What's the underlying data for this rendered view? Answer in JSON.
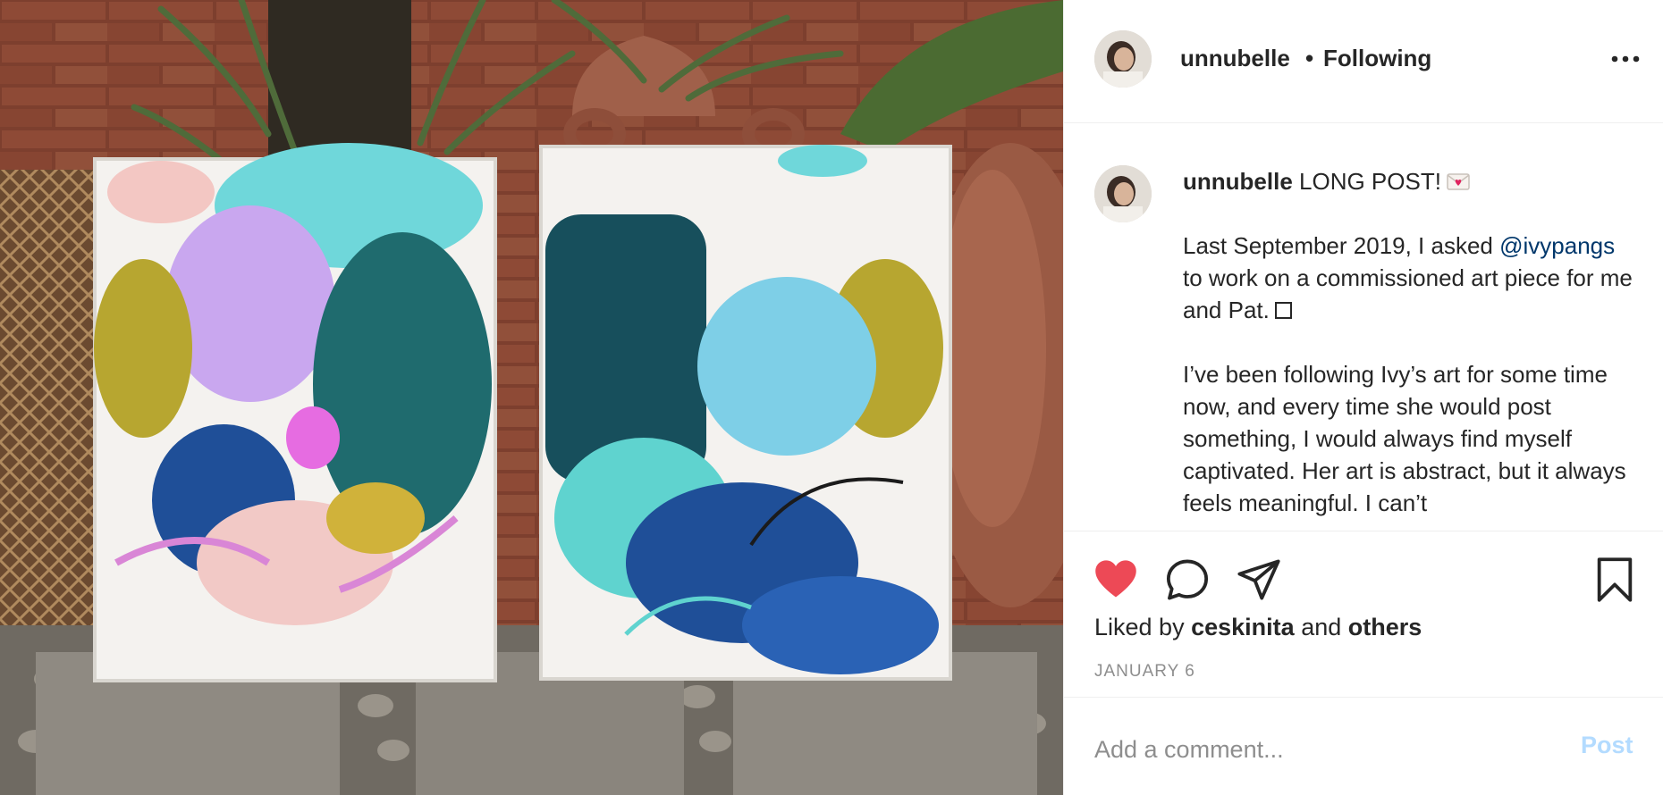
{
  "header": {
    "username": "unnubelle",
    "separator": "•",
    "follow_status": "Following",
    "more_icon": "more-horizontal-icon"
  },
  "caption": {
    "username": "unnubelle",
    "title": "LONG POST!",
    "emoji_icon": "love-letter-icon",
    "p1_pre": "Last September 2019, I asked",
    "mention": "@ivypangs",
    "p1_post": "to work on a commissioned art piece for me and Pat.",
    "p2": "I’ve been following Ivy’s art for some time now, and every time she would post something, I would always find myself captivated. Her art is abstract, but it always feels meaningful. I can’t"
  },
  "actions": {
    "like_icon": "heart-filled-icon",
    "comment_icon": "comment-icon",
    "share_icon": "paper-plane-icon",
    "save_icon": "bookmark-icon",
    "liked_prefix": "Liked by",
    "liked_user": "ceskinita",
    "liked_and": "and",
    "liked_others": "others",
    "date": "JANUARY 6"
  },
  "comment": {
    "placeholder": "Add a comment...",
    "post_label": "Post"
  },
  "colors": {
    "like": "#ed4956",
    "mention": "#00376b",
    "post_disabled": "#b3dbff",
    "muted": "#8e8e8e"
  }
}
